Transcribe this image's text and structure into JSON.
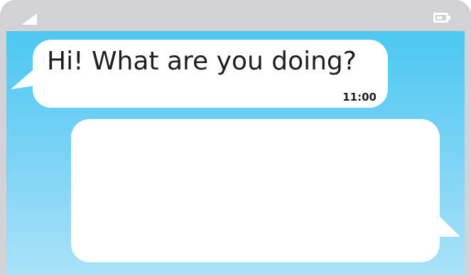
{
  "status_bar": {
    "signal_icon": "signal-icon",
    "battery_icon": "battery-icon",
    "background": "#d2d2d4"
  },
  "conversation": {
    "incoming": {
      "text": "Hi! What are you doing?",
      "time": "11:00"
    },
    "outgoing": {
      "text": ""
    }
  },
  "colors": {
    "screen_top": "#4ac8f2",
    "screen_bottom": "#a9e2f8",
    "bubble": "#ffffff",
    "text": "#1e1e1e"
  }
}
